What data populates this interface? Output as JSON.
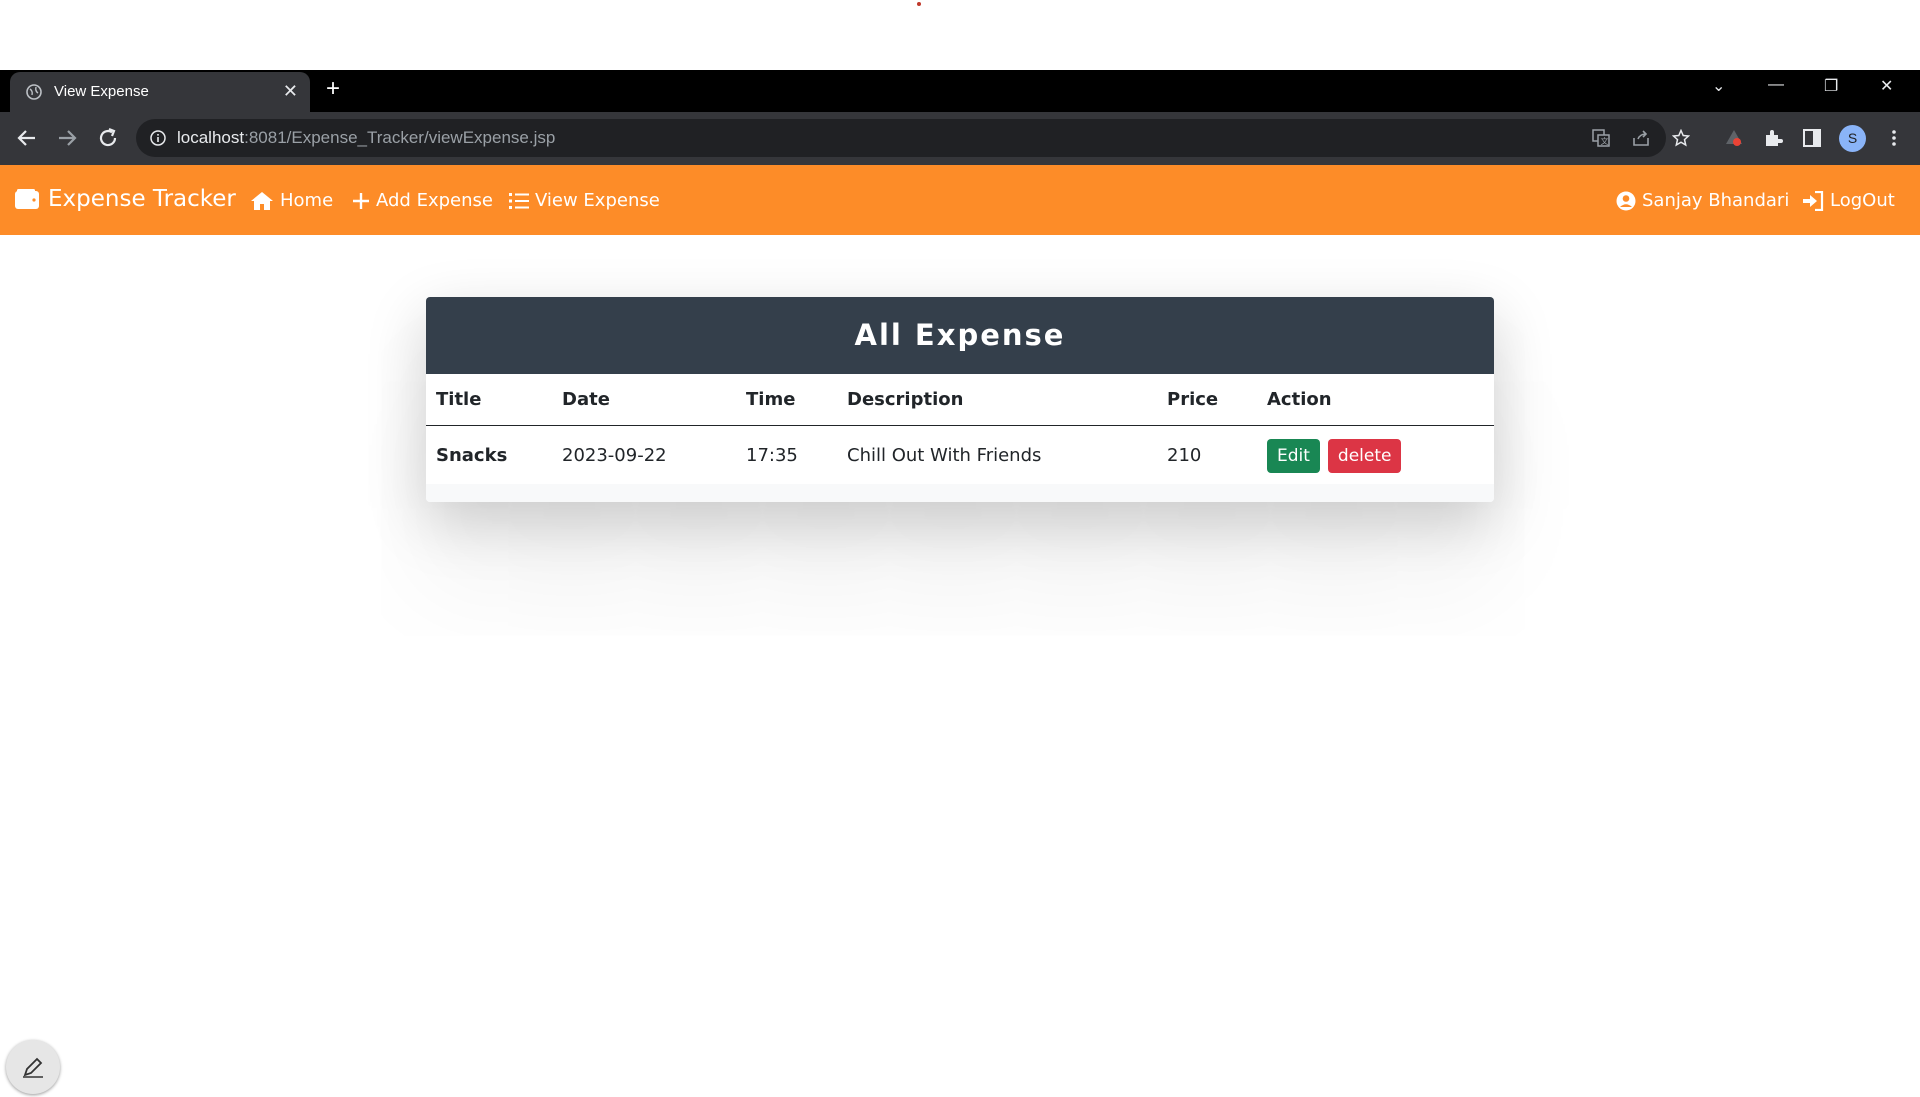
{
  "browser": {
    "tab_title": "View Expense",
    "tab_close": "✕",
    "new_tab": "+",
    "url_host": "localhost",
    "url_rest": ":8081/Expense_Tracker/viewExpense.jsp",
    "profile_initial": "S",
    "window_controls": [
      "⌄",
      "—",
      "❐",
      "✕"
    ]
  },
  "navbar": {
    "brand": "Expense Tracker",
    "links": [
      {
        "label": "Home",
        "icon": "home-icon"
      },
      {
        "label": "Add Expense",
        "icon": "plus-icon"
      },
      {
        "label": "View Expense",
        "icon": "list-icon"
      }
    ],
    "user": {
      "label": "Sanjay Bhandari",
      "icon": "user-circle-icon"
    },
    "logout": {
      "label": "LogOut",
      "icon": "sign-in-icon"
    }
  },
  "card": {
    "title": "All Expense",
    "columns": [
      "Title",
      "Date",
      "Time",
      "Description",
      "Price",
      "Action"
    ],
    "rows": [
      {
        "title": "Snacks",
        "date": "2023-09-22",
        "time": "17:35",
        "description": "Chill Out With Friends",
        "price": "210",
        "edit": "Edit",
        "delete": "delete"
      }
    ]
  },
  "colors": {
    "navbar": "#fd8c28",
    "card_header": "#343f4b",
    "edit": "#198754",
    "delete": "#dc3545"
  }
}
